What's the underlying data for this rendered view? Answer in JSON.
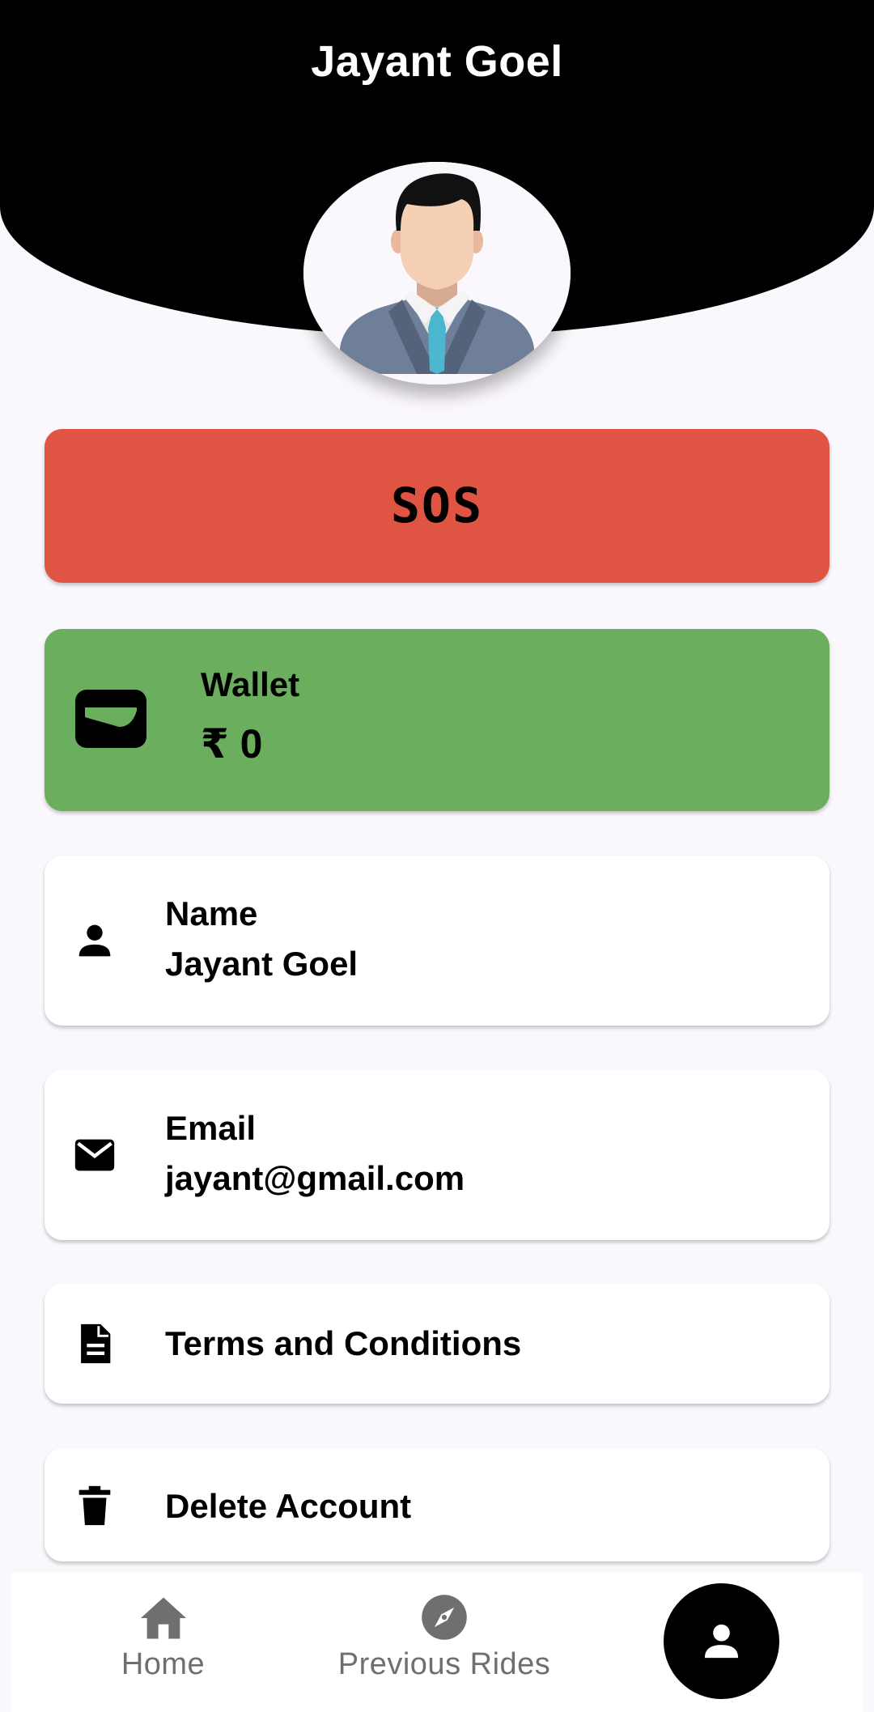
{
  "header": {
    "title": "Jayant Goel"
  },
  "sos": {
    "label": "SOS",
    "color": "#e05443"
  },
  "wallet": {
    "title": "Wallet",
    "amount": "₹ 0",
    "color": "#6aae5e",
    "icon": "wallet-icon"
  },
  "profile": {
    "name": {
      "label": "Name",
      "value": "Jayant Goel",
      "icon": "person-icon"
    },
    "email": {
      "label": "Email",
      "value": "jayant@gmail.com",
      "icon": "mail-icon"
    }
  },
  "links": {
    "terms": {
      "label": "Terms and Conditions",
      "icon": "document-icon"
    },
    "delete": {
      "label": "Delete Account",
      "icon": "trash-icon"
    }
  },
  "nav": {
    "items": [
      {
        "label": "Home",
        "icon": "home-icon"
      },
      {
        "label": "Previous Rides",
        "icon": "compass-icon"
      },
      {
        "label": "",
        "icon": "profile-icon",
        "active": true
      }
    ]
  }
}
